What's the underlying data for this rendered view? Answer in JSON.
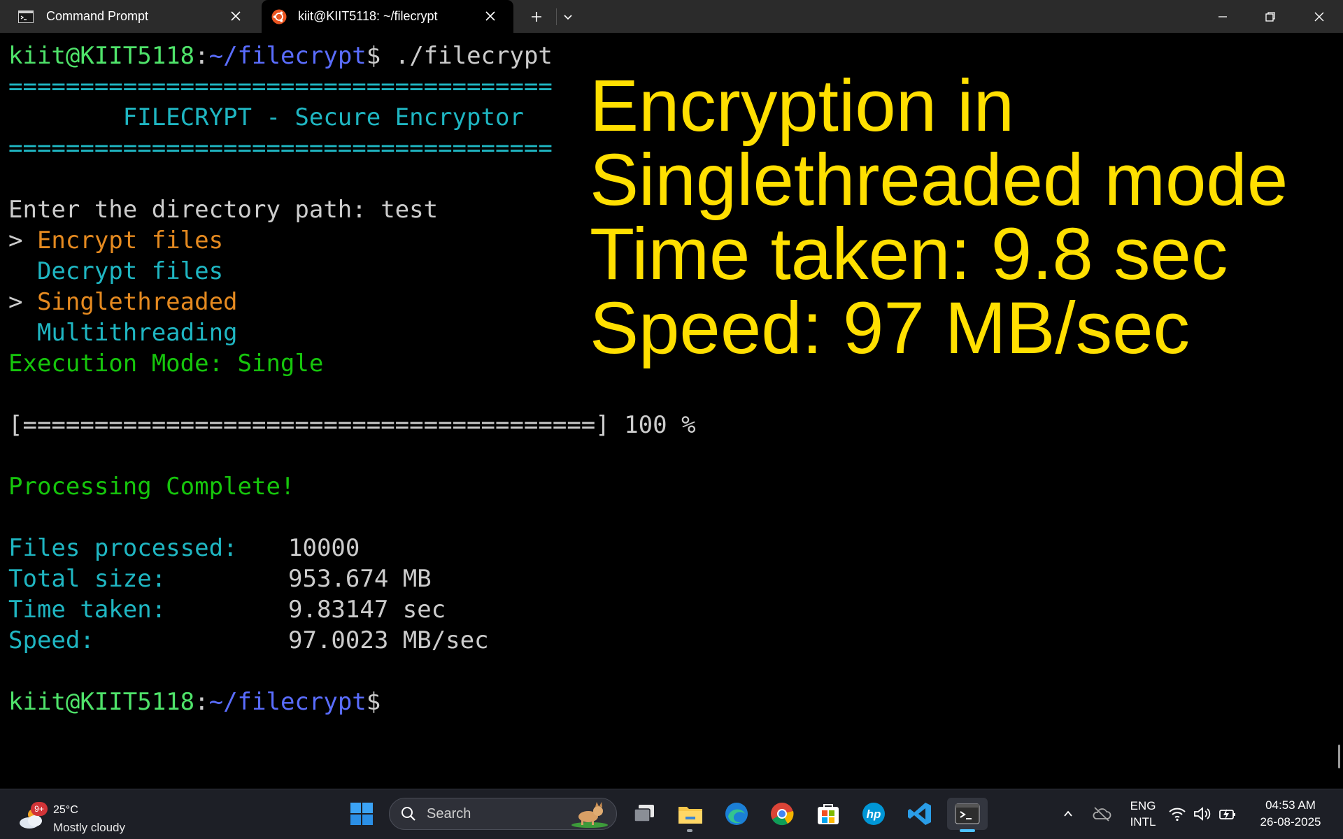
{
  "tabs": [
    {
      "title": "Command Prompt",
      "icon": "cmd-icon"
    },
    {
      "title": "kiit@KIIT5118: ~/filecrypt",
      "icon": "ubuntu-icon"
    }
  ],
  "terminal": {
    "prompt_user": "kiit@KIIT5118",
    "prompt_colon": ":",
    "prompt_path": "~/filecrypt",
    "prompt_dollar": "$",
    "command": " ./filecrypt",
    "separator": "======================================",
    "banner": "        FILECRYPT - Secure Encryptor",
    "dir_prompt": "Enter the directory path: test",
    "menu_pointer": "> ",
    "menu_indent": "  ",
    "menu_action_selected": "Encrypt files",
    "menu_action_other": "Decrypt files",
    "menu_mode_selected": "Singlethreaded",
    "menu_mode_other": "Multithreading",
    "execution_mode": "Execution Mode: Single",
    "progress_bar": "[========================================] 100 %",
    "progress_percent": 100,
    "complete": "Processing Complete!",
    "stats": [
      {
        "label": "Files processed:",
        "value": "10000"
      },
      {
        "label": "Total size:",
        "value": "953.674 MB"
      },
      {
        "label": "Time taken:",
        "value": "9.83147 sec"
      },
      {
        "label": "Speed:",
        "value": "97.0023 MB/sec"
      }
    ]
  },
  "overlay": {
    "lines": [
      "Encryption in",
      "Singlethreaded mode",
      "Time taken: 9.8 sec",
      "Speed: 97 MB/sec"
    ],
    "color": "#ffdf00"
  },
  "taskbar": {
    "weather_badge": "9+",
    "weather_temp": "25°C",
    "weather_condition": "Mostly cloudy",
    "search_placeholder": "Search",
    "lang_line1": "ENG",
    "lang_line2": "INTL",
    "time": "04:53 AM",
    "date": "26-08-2025"
  },
  "colors": {
    "prompt_user": "#4fe36a",
    "prompt_path": "#5a6dff",
    "teal": "#1fb6c2",
    "orange": "#e58a20",
    "green": "#16c60c"
  }
}
